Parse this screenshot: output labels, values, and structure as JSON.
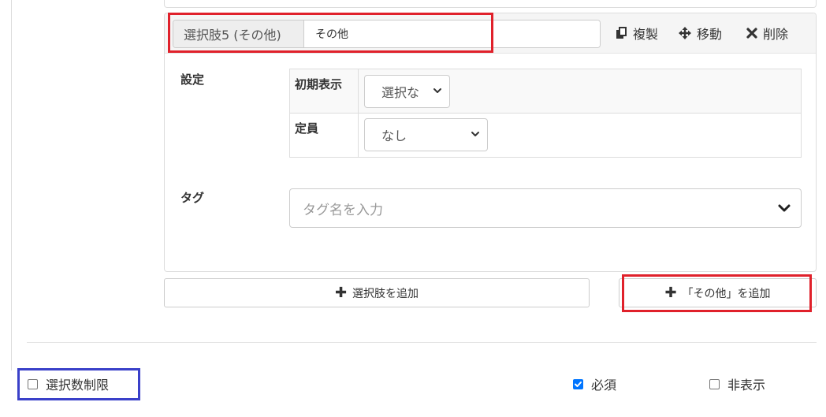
{
  "choice": {
    "addon_label": "選択肢5 (その他)",
    "input_value": "その他",
    "actions": {
      "copy_label": "複製",
      "move_label": "移動",
      "delete_label": "削除"
    }
  },
  "settings": {
    "label": "設定",
    "initial_display": {
      "header": "初期表示",
      "selected": "選択な"
    },
    "capacity": {
      "header": "定員",
      "selected": "なし"
    }
  },
  "tag": {
    "label": "タグ",
    "placeholder": "タグ名を入力"
  },
  "buttons": {
    "add_choice": "選択肢を追加",
    "add_other": "「その他」を追加"
  },
  "footer": {
    "limit_selection": {
      "label": "選択数制限",
      "checked": false
    },
    "required": {
      "label": "必須",
      "checked": true
    },
    "hidden": {
      "label": "非表示",
      "checked": false
    }
  },
  "colors": {
    "highlight_red": "#e0212b",
    "highlight_blue": "#3a40c9",
    "checkbox_checked": "#0075ff"
  }
}
